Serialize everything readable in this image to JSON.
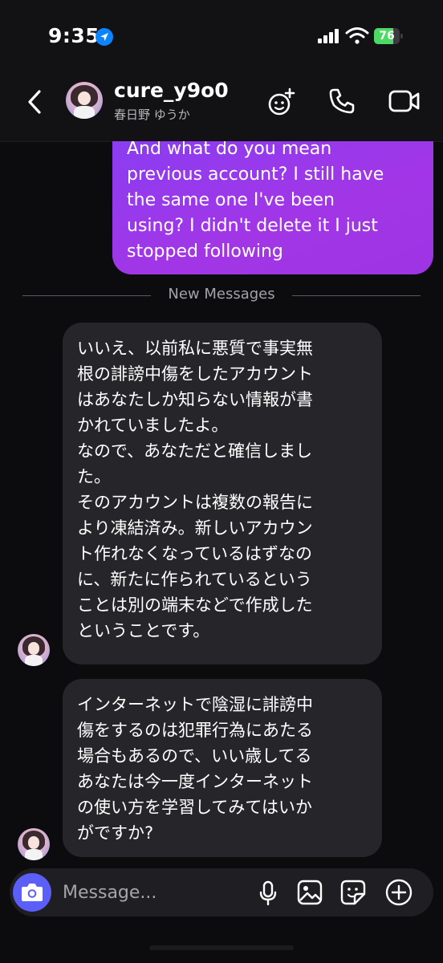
{
  "status_bar": {
    "time": "9:35",
    "battery": "76",
    "battery_level": 0.76
  },
  "header": {
    "username": "cure_y9o0",
    "display_name": "春日野 ゆうか"
  },
  "messages": {
    "outgoing": {
      "lines": [
        "And what do you mean",
        "previous account? I still have",
        "the same one I've been",
        "using? I didn't delete it I just",
        "stopped following"
      ]
    },
    "separator": "New Messages",
    "incoming": [
      {
        "lines": [
          "いいえ、以前私に悪質で事実無",
          "根の誹謗中傷をしたアカウント",
          "はあなたしか知らない情報が書",
          "かれていましたよ。",
          "なので、あなただと確信しまし",
          "た。",
          "そのアカウントは複数の報告に",
          "より凍結済み。新しいアカウン",
          "ト作れなくなっているはずなの",
          "に、新たに作られているという",
          "ことは別の端末などで作成した",
          "ということです。"
        ]
      },
      {
        "lines": [
          "インターネットで陰湿に誹謗中",
          "傷をするのは犯罪行為にあたる",
          "場合もあるので、いい歳してる",
          "あなたは今一度インターネット",
          "の使い方を学習してみてはいか",
          "がですか?"
        ]
      }
    ]
  },
  "composer": {
    "placeholder": "Message..."
  },
  "colors": {
    "background": "#0c0c0e",
    "outgoing_bubble": "#9d34e3",
    "incoming_bubble": "#26262a",
    "camera_button": "#5b5ef7",
    "battery_green": "#4cd964"
  }
}
